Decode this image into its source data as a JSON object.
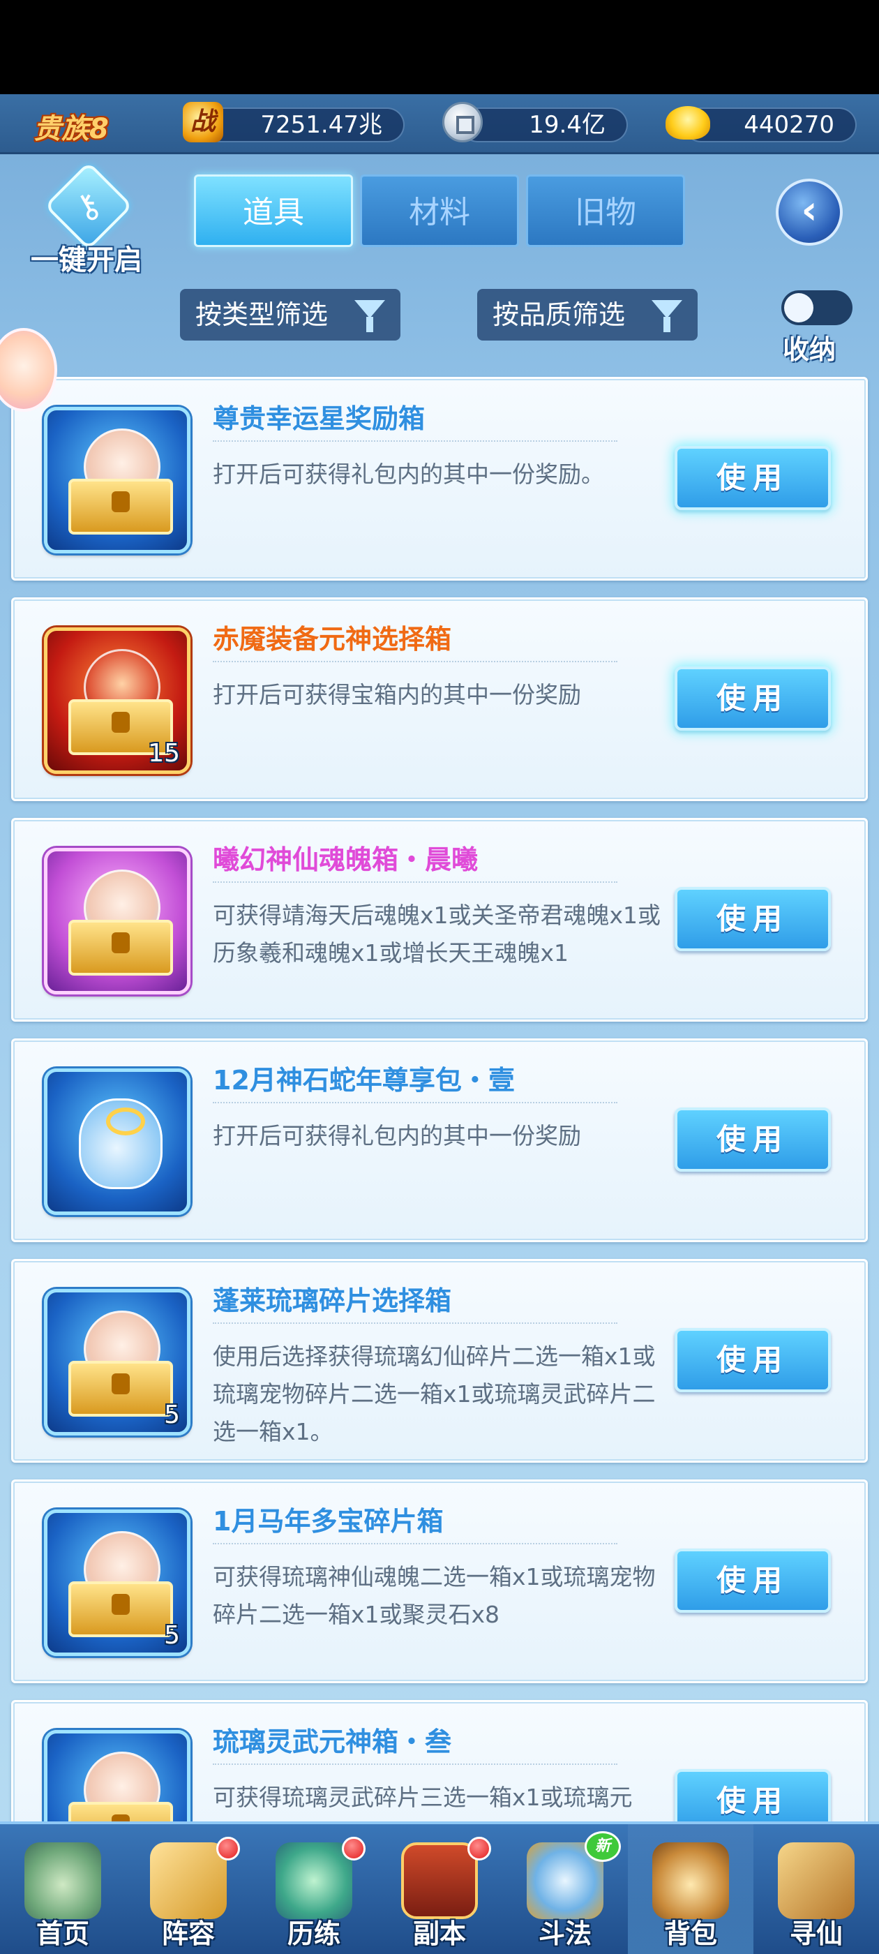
{
  "resources": {
    "vip": "贵族8",
    "power_icon": "战",
    "power": "7251.47兆",
    "silver": "19.4亿",
    "gold": "440270"
  },
  "top": {
    "one_key_open": "一键开启",
    "tabs": [
      {
        "label": "道具",
        "active": true
      },
      {
        "label": "材料",
        "active": false
      },
      {
        "label": "旧物",
        "active": false
      }
    ],
    "back_icon": "back-arrow-icon",
    "back_glyph": "‹",
    "filter_type": "按类型筛选",
    "filter_quality": "按品质筛选",
    "collapse_label": "收纳"
  },
  "items": [
    {
      "title": "尊贵幸运星奖励箱",
      "title_color": "#2f8fe0",
      "desc": "打开后可获得礼包内的其中一份奖励。",
      "count": "",
      "button": "使用",
      "icon_style": "blue-chest"
    },
    {
      "title": "赤魇装备元神选择箱",
      "title_color": "#f06a14",
      "desc": "打开后可获得宝箱内的其中一份奖励",
      "count": "15",
      "button": "使用",
      "icon_style": "red-chest"
    },
    {
      "title": "曦幻神仙魂魄箱・晨曦",
      "title_color": "#e04bd8",
      "desc": "可获得靖海天后魂魄x1或关圣帝君魂魄x1或历象羲和魂魄x1或增长天王魂魄x1",
      "count": "",
      "button": "使用",
      "icon_style": "purple-chest"
    },
    {
      "title": "12月神石蛇年尊享包・壹",
      "title_color": "#2f8fe0",
      "desc": "打开后可获得礼包内的其中一份奖励",
      "count": "",
      "button": "使用",
      "icon_style": "blue-bag"
    },
    {
      "title": "蓬莱琉璃碎片选择箱",
      "title_color": "#2f8fe0",
      "desc": "使用后选择获得琉璃幻仙碎片二选一箱x1或琉璃宠物碎片二选一箱x1或琉璃灵武碎片二选一箱x1。",
      "count": "5",
      "button": "使用",
      "icon_style": "blue-chest"
    },
    {
      "title": "1月马年多宝碎片箱",
      "title_color": "#2f8fe0",
      "desc": "可获得琉璃神仙魂魄二选一箱x1或琉璃宠物碎片二选一箱x1或聚灵石x8",
      "count": "5",
      "button": "使用",
      "icon_style": "blue-chest"
    },
    {
      "title": "琉璃灵武元神箱・叁",
      "title_color": "#2f8fe0",
      "desc": "可获得琉璃灵武碎片三选一箱x1或琉璃元",
      "count": "",
      "button": "使用",
      "icon_style": "blue-chest"
    }
  ],
  "nav": [
    {
      "label": "首页",
      "icon": "home-icon",
      "dot": false,
      "new": false,
      "active": false
    },
    {
      "label": "阵容",
      "icon": "lineup-icon",
      "dot": true,
      "new": false,
      "active": false
    },
    {
      "label": "历练",
      "icon": "training-icon",
      "dot": true,
      "new": false,
      "active": false
    },
    {
      "label": "副本",
      "icon": "dungeon-icon",
      "dot": true,
      "new": false,
      "active": false
    },
    {
      "label": "斗法",
      "icon": "battle-icon",
      "dot": false,
      "new": true,
      "new_text": "新",
      "active": false
    },
    {
      "label": "背包",
      "icon": "backpack-icon",
      "dot": false,
      "new": false,
      "active": true
    },
    {
      "label": "寻仙",
      "icon": "seek-immortal-icon",
      "dot": false,
      "new": false,
      "active": false
    }
  ]
}
